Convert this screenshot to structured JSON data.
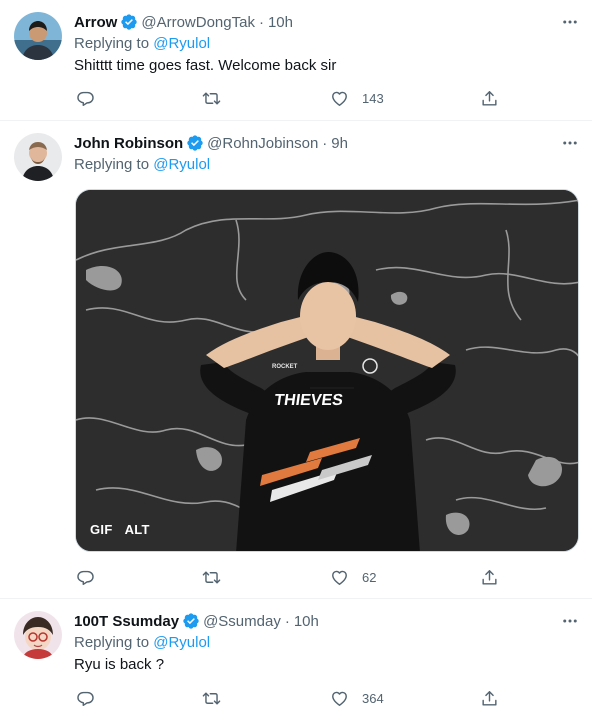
{
  "tweets": [
    {
      "display_name": "Arrow",
      "handle": "@ArrowDongTak",
      "time": "10h",
      "replying_prefix": "Replying to",
      "replying_to": "@Ryulol",
      "text": "Shitttt time goes fast. Welcome back sir",
      "replies": "",
      "retweets": "",
      "likes": "143"
    },
    {
      "display_name": "John Robinson",
      "handle": "@RohnJobinson",
      "time": "9h",
      "replying_prefix": "Replying to",
      "replying_to": "@Ryulol",
      "media": {
        "type": "gif",
        "badge_gif": "GIF",
        "badge_alt": "ALT",
        "shirt_logo": "ROCKET",
        "shirt_text": "THIEVES"
      },
      "replies": "",
      "retweets": "",
      "likes": "62"
    },
    {
      "display_name": "100T Ssumday",
      "handle": "@Ssumday",
      "time": "10h",
      "replying_prefix": "Replying to",
      "replying_to": "@Ryulol",
      "text": "Ryu is back ?",
      "replies": "",
      "retweets": "",
      "likes": "364"
    }
  ],
  "icons": {
    "verified": "verified-badge-icon",
    "more": "more-horizontal-icon",
    "reply": "reply-bubble-icon",
    "retweet": "retweet-icon",
    "like": "heart-icon",
    "share": "share-upload-icon"
  },
  "colors": {
    "accent": "#1d9bf0",
    "secondary_text": "#536471",
    "primary_text": "#0f1419",
    "divider": "#eff3f4"
  }
}
